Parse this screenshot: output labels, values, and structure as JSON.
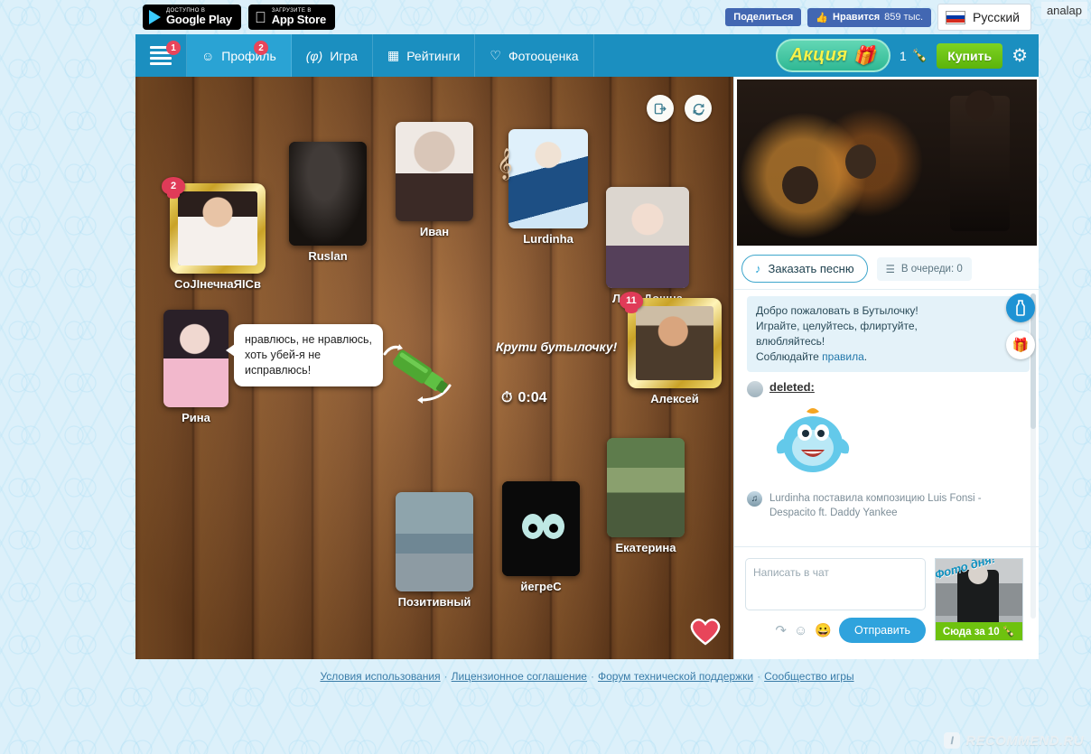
{
  "topbar": {
    "google_play": {
      "small": "доступно в",
      "big": "Google Play"
    },
    "app_store": {
      "small": "Загрузите в",
      "big": "App Store"
    },
    "share_label": "Поделиться",
    "like_label": "Нравится",
    "like_count": "859 тыс.",
    "language": "Русский",
    "corner_text": "analap"
  },
  "nav": {
    "burger_badge": "1",
    "items": [
      {
        "label": "Профиль",
        "icon": "user-icon",
        "badge": "2"
      },
      {
        "label": "Игра",
        "icon": "bottle-icon",
        "badge": ""
      },
      {
        "label": "Рейтинги",
        "icon": "podium-icon",
        "badge": ""
      },
      {
        "label": "Фотооценка",
        "icon": "heart-photo-icon",
        "badge": ""
      }
    ],
    "promo_label": "Акция",
    "coin_count": "1",
    "buy_label": "Купить"
  },
  "board": {
    "top_icons": [
      {
        "name": "exit-icon",
        "glyph": "⇥"
      },
      {
        "name": "refresh-icon",
        "glyph": "⟳"
      }
    ],
    "players": [
      {
        "name": "СоЈӀнечнаЯӀСв",
        "badge": "2",
        "crowned": true
      },
      {
        "name": "Ruslan",
        "badge": ""
      },
      {
        "name": "Иван",
        "badge": ""
      },
      {
        "name": "Lurdinha",
        "badge": ""
      },
      {
        "name": "Леся Дошна",
        "badge": ""
      },
      {
        "name": "Алексей",
        "badge": "11",
        "crowned": true
      },
      {
        "name": "Рина",
        "badge": ""
      },
      {
        "name": "Екатерина",
        "badge": ""
      },
      {
        "name": "Позитивный",
        "badge": ""
      },
      {
        "name": "йегреС",
        "badge": ""
      }
    ],
    "bubble_text": "нравлюсь, не нравлюсь, хоть убей-я не исправлюсь!",
    "spin_text": "Крути бутылочку!",
    "timer": "0:04"
  },
  "right": {
    "song_button": "Заказать песню",
    "queue_label": "В очереди: 0",
    "system_message_line1": "Добро пожаловать в Бутылочку!",
    "system_message_line2": "Играйте, целуйтесь, флиртуйте,",
    "system_message_line3": "влюбляйтесь!",
    "system_message_line4_prefix": "Соблюдайте ",
    "system_message_rules_link": "правила",
    "system_message_line4_suffix": ".",
    "chat_author": "deleted",
    "chat_author_colon": ":",
    "notice_text": "Lurdinha поставила композицию Luis Fonsi - Despacito ft. Daddy Yankee",
    "composer_placeholder": "Написать в чат",
    "composer_value": "",
    "send_label": "Отправить",
    "photo_of_day_tag": "Фото дня!",
    "photo_of_day_cta": "Сюда за 10",
    "side_actions": [
      {
        "name": "bottle-action-icon",
        "glyph": "🍼"
      },
      {
        "name": "gift-action-icon",
        "glyph": "🎁"
      }
    ]
  },
  "footer": {
    "links": [
      "Условия использования",
      "Лицензионное соглашение",
      "Форум технической поддержки",
      "Сообщество игры"
    ],
    "separator": "·"
  },
  "watermark": {
    "text": "RECOMMEND.RU",
    "mark": "I"
  }
}
